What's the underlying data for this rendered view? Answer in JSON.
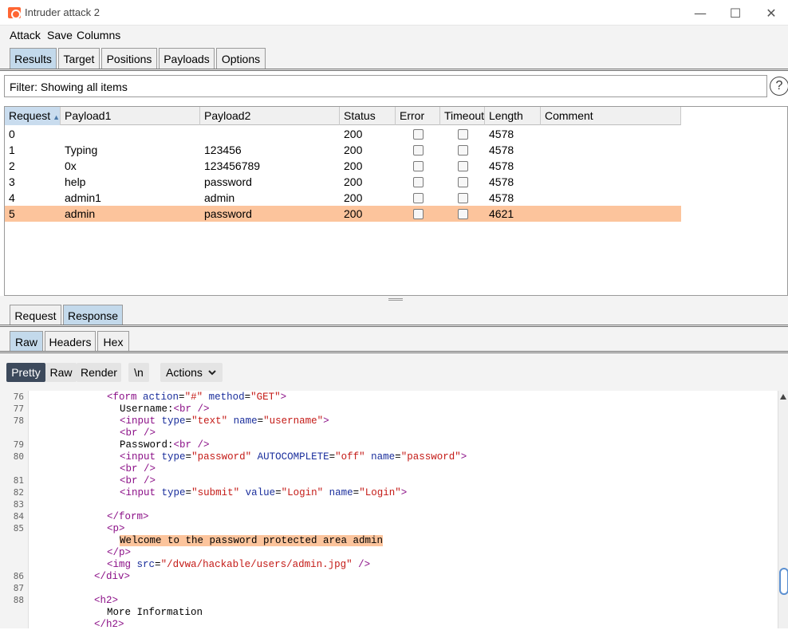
{
  "window": {
    "title": "Intruder attack 2",
    "controls": {
      "minimize": "—",
      "maximize": "☐",
      "close": "✕"
    }
  },
  "menu": [
    "Attack",
    "Save",
    "Columns"
  ],
  "main_tabs": [
    {
      "label": "Results",
      "active": true
    },
    {
      "label": "Target",
      "active": false
    },
    {
      "label": "Positions",
      "active": false
    },
    {
      "label": "Payloads",
      "active": false
    },
    {
      "label": "Options",
      "active": false
    }
  ],
  "filter": {
    "text": "Filter: Showing all items",
    "help_glyph": "?"
  },
  "table": {
    "headers": [
      "Request",
      "Payload1",
      "Payload2",
      "Status",
      "Error",
      "Timeout",
      "Length",
      "Comment"
    ],
    "sort_column": "Request",
    "rows": [
      {
        "request": "0",
        "payload1": "",
        "payload2": "",
        "status": "200",
        "error": false,
        "timeout": false,
        "length": "4578",
        "comment": "",
        "selected": false
      },
      {
        "request": "1",
        "payload1": "Typing",
        "payload2": "123456",
        "status": "200",
        "error": false,
        "timeout": false,
        "length": "4578",
        "comment": "",
        "selected": false
      },
      {
        "request": "2",
        "payload1": "0x",
        "payload2": "123456789",
        "status": "200",
        "error": false,
        "timeout": false,
        "length": "4578",
        "comment": "",
        "selected": false
      },
      {
        "request": "3",
        "payload1": "help",
        "payload2": "password",
        "status": "200",
        "error": false,
        "timeout": false,
        "length": "4578",
        "comment": "",
        "selected": false
      },
      {
        "request": "4",
        "payload1": "admin1",
        "payload2": "admin",
        "status": "200",
        "error": false,
        "timeout": false,
        "length": "4578",
        "comment": "",
        "selected": false
      },
      {
        "request": "5",
        "payload1": "admin",
        "payload2": "password",
        "status": "200",
        "error": false,
        "timeout": false,
        "length": "4621",
        "comment": "",
        "selected": true
      }
    ]
  },
  "message_tabs": [
    {
      "label": "Request",
      "active": false
    },
    {
      "label": "Response",
      "active": true
    }
  ],
  "view_tabs": [
    {
      "label": "Raw",
      "active": true
    },
    {
      "label": "Headers",
      "active": false
    },
    {
      "label": "Hex",
      "active": false
    }
  ],
  "toolbar": {
    "pretty": "Pretty",
    "raw": "Raw",
    "render": "Render",
    "newline": "\\n",
    "actions": "Actions"
  },
  "editor": {
    "line_numbers": [
      "76",
      "77",
      "78",
      "",
      "79",
      "80",
      "",
      "81",
      "82",
      "83",
      "84",
      "85",
      "",
      "",
      "",
      "86",
      "87",
      "88",
      "",
      ""
    ],
    "lines": [
      "<form action=\"#\" method=\"GET\">",
      "Username:<br />",
      "<input type=\"text\" name=\"username\">",
      "<br />",
      "Password:<br />",
      "<input type=\"password\" AUTOCOMPLETE=\"off\" name=\"password\">",
      "<br />",
      "<br />",
      "<input type=\"submit\" value=\"Login\" name=\"Login\">",
      "",
      "</form>",
      "<p>",
      "Welcome to the password protected area admin",
      "</p>",
      "<img src=\"/dvwa/hackable/users/admin.jpg\" />",
      "</div>",
      "",
      "<h2>",
      "More Information",
      "</h2>"
    ]
  }
}
